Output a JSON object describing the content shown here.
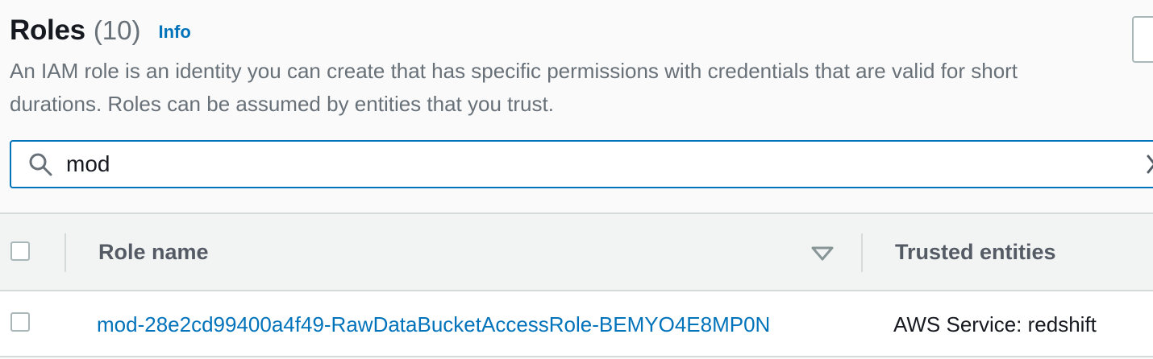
{
  "header": {
    "title": "Roles",
    "count": "(10)",
    "info_link": "Info",
    "description": "An IAM role is an identity you can create that has specific permissions with credentials that are valid for short durations. Roles can be assumed by entities that you trust."
  },
  "search": {
    "value": "mod",
    "icon": "search-icon",
    "clear_icon": "close-icon"
  },
  "table": {
    "columns": [
      "Role name",
      "Trusted entities"
    ],
    "sort_icon": "caret-down-icon",
    "rows": [
      {
        "role_name": "mod-28e2cd99400a4f49-RawDataBucketAccessRole-BEMYO4E8MP0N",
        "trusted_entities": "AWS Service: redshift"
      }
    ]
  },
  "colors": {
    "link": "#0073bb",
    "focus_border": "#0073bb",
    "header_background": "#f2f3f3",
    "border": "#d5dbdb",
    "muted_text": "#687078"
  }
}
